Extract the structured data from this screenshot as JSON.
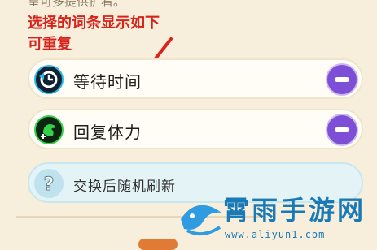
{
  "header": {
    "top_text": "皇可多提供扩看。"
  },
  "annotation": {
    "line1": "选择的词条显示如下",
    "line2": "可重复",
    "color": "#d8231b"
  },
  "rows": [
    {
      "label": "等待时间",
      "icon": "clock-return-icon",
      "action": "remove"
    },
    {
      "label": "回复体力",
      "icon": "stamina-restore-icon",
      "action": "remove"
    },
    {
      "label": "交换后随机刷新",
      "icon": "question-icon"
    }
  ],
  "watermark": {
    "title": "霄雨手游网",
    "url": "www.aliyun1.com",
    "color": "#1a7ab8"
  },
  "colors": {
    "background": "#f7eedc",
    "remove_button": "#7c4fd6"
  }
}
